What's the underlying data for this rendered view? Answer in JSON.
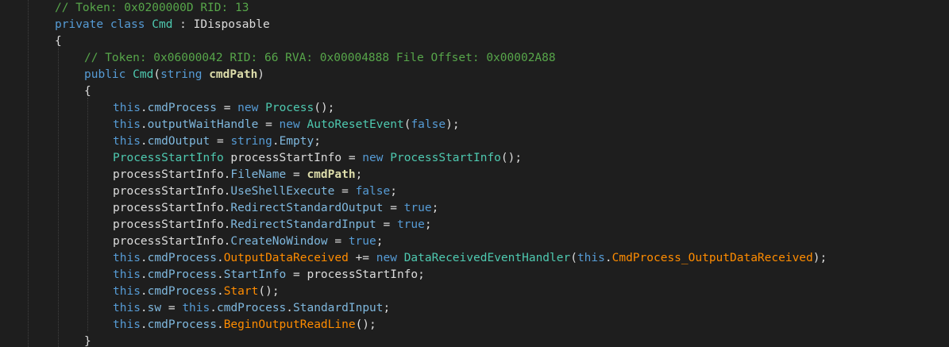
{
  "editor": {
    "lines": [
      {
        "indent": 0,
        "tokens": [
          {
            "t": "// Token: 0x0200000D RID: 13",
            "c": "cm"
          }
        ]
      },
      {
        "indent": 0,
        "tokens": [
          {
            "t": "private",
            "c": "kw"
          },
          {
            "t": " ",
            "c": "pn"
          },
          {
            "t": "class",
            "c": "kw"
          },
          {
            "t": " ",
            "c": "pn"
          },
          {
            "t": "Cmd",
            "c": "ty"
          },
          {
            "t": " : ",
            "c": "pn"
          },
          {
            "t": "IDisposable",
            "c": "pn"
          }
        ]
      },
      {
        "indent": 0,
        "tokens": [
          {
            "t": "{",
            "c": "pn"
          }
        ]
      },
      {
        "indent": 1,
        "tokens": [
          {
            "t": "// Token: 0x06000042 RID: 66 RVA: 0x00004888 File Offset: 0x00002A88",
            "c": "cm"
          }
        ]
      },
      {
        "indent": 1,
        "tokens": [
          {
            "t": "public",
            "c": "kw"
          },
          {
            "t": " ",
            "c": "pn"
          },
          {
            "t": "Cmd",
            "c": "ty"
          },
          {
            "t": "(",
            "c": "pn"
          },
          {
            "t": "string",
            "c": "kw"
          },
          {
            "t": " ",
            "c": "pn"
          },
          {
            "t": "cmdPath",
            "c": "prm"
          },
          {
            "t": ")",
            "c": "pn"
          }
        ]
      },
      {
        "indent": 1,
        "tokens": [
          {
            "t": "{",
            "c": "pn"
          }
        ]
      },
      {
        "indent": 2,
        "tokens": [
          {
            "t": "this",
            "c": "kw"
          },
          {
            "t": ".",
            "c": "pn"
          },
          {
            "t": "cmdProcess",
            "c": "pinfo"
          },
          {
            "t": " = ",
            "c": "pn"
          },
          {
            "t": "new",
            "c": "kw"
          },
          {
            "t": " ",
            "c": "pn"
          },
          {
            "t": "Process",
            "c": "ty"
          },
          {
            "t": "();",
            "c": "pn"
          }
        ]
      },
      {
        "indent": 2,
        "tokens": [
          {
            "t": "this",
            "c": "kw"
          },
          {
            "t": ".",
            "c": "pn"
          },
          {
            "t": "outputWaitHandle",
            "c": "pinfo"
          },
          {
            "t": " = ",
            "c": "pn"
          },
          {
            "t": "new",
            "c": "kw"
          },
          {
            "t": " ",
            "c": "pn"
          },
          {
            "t": "AutoResetEvent",
            "c": "ty"
          },
          {
            "t": "(",
            "c": "pn"
          },
          {
            "t": "false",
            "c": "kw"
          },
          {
            "t": ");",
            "c": "pn"
          }
        ]
      },
      {
        "indent": 2,
        "tokens": [
          {
            "t": "this",
            "c": "kw"
          },
          {
            "t": ".",
            "c": "pn"
          },
          {
            "t": "cmdOutput",
            "c": "pinfo"
          },
          {
            "t": " = ",
            "c": "pn"
          },
          {
            "t": "string",
            "c": "kw"
          },
          {
            "t": ".",
            "c": "pn"
          },
          {
            "t": "Empty",
            "c": "pinfo"
          },
          {
            "t": ";",
            "c": "pn"
          }
        ]
      },
      {
        "indent": 2,
        "tokens": [
          {
            "t": "ProcessStartInfo",
            "c": "ty"
          },
          {
            "t": " processStartInfo = ",
            "c": "loc"
          },
          {
            "t": "new",
            "c": "kw"
          },
          {
            "t": " ",
            "c": "pn"
          },
          {
            "t": "ProcessStartInfo",
            "c": "ty"
          },
          {
            "t": "();",
            "c": "pn"
          }
        ]
      },
      {
        "indent": 2,
        "tokens": [
          {
            "t": "processStartInfo.",
            "c": "loc"
          },
          {
            "t": "FileName",
            "c": "pinfo"
          },
          {
            "t": " = ",
            "c": "pn"
          },
          {
            "t": "cmdPath",
            "c": "prm"
          },
          {
            "t": ";",
            "c": "pn"
          }
        ]
      },
      {
        "indent": 2,
        "tokens": [
          {
            "t": "processStartInfo.",
            "c": "loc"
          },
          {
            "t": "UseShellExecute",
            "c": "pinfo"
          },
          {
            "t": " = ",
            "c": "pn"
          },
          {
            "t": "false",
            "c": "kw"
          },
          {
            "t": ";",
            "c": "pn"
          }
        ]
      },
      {
        "indent": 2,
        "tokens": [
          {
            "t": "processStartInfo.",
            "c": "loc"
          },
          {
            "t": "RedirectStandardOutput",
            "c": "pinfo"
          },
          {
            "t": " = ",
            "c": "pn"
          },
          {
            "t": "true",
            "c": "kw"
          },
          {
            "t": ";",
            "c": "pn"
          }
        ]
      },
      {
        "indent": 2,
        "tokens": [
          {
            "t": "processStartInfo.",
            "c": "loc"
          },
          {
            "t": "RedirectStandardInput",
            "c": "pinfo"
          },
          {
            "t": " = ",
            "c": "pn"
          },
          {
            "t": "true",
            "c": "kw"
          },
          {
            "t": ";",
            "c": "pn"
          }
        ]
      },
      {
        "indent": 2,
        "tokens": [
          {
            "t": "processStartInfo.",
            "c": "loc"
          },
          {
            "t": "CreateNoWindow",
            "c": "pinfo"
          },
          {
            "t": " = ",
            "c": "pn"
          },
          {
            "t": "true",
            "c": "kw"
          },
          {
            "t": ";",
            "c": "pn"
          }
        ]
      },
      {
        "indent": 2,
        "tokens": [
          {
            "t": "this",
            "c": "kw"
          },
          {
            "t": ".",
            "c": "pn"
          },
          {
            "t": "cmdProcess",
            "c": "pinfo"
          },
          {
            "t": ".",
            "c": "pn"
          },
          {
            "t": "OutputDataReceived",
            "c": "ev"
          },
          {
            "t": " += ",
            "c": "pn"
          },
          {
            "t": "new",
            "c": "kw"
          },
          {
            "t": " ",
            "c": "pn"
          },
          {
            "t": "DataReceivedEventHandler",
            "c": "ty"
          },
          {
            "t": "(",
            "c": "pn"
          },
          {
            "t": "this",
            "c": "kw"
          },
          {
            "t": ".",
            "c": "pn"
          },
          {
            "t": "CmdProcess_OutputDataReceived",
            "c": "mm"
          },
          {
            "t": ");",
            "c": "pn"
          }
        ]
      },
      {
        "indent": 2,
        "tokens": [
          {
            "t": "this",
            "c": "kw"
          },
          {
            "t": ".",
            "c": "pn"
          },
          {
            "t": "cmdProcess",
            "c": "pinfo"
          },
          {
            "t": ".",
            "c": "pn"
          },
          {
            "t": "StartInfo",
            "c": "pinfo"
          },
          {
            "t": " = processStartInfo;",
            "c": "loc"
          }
        ]
      },
      {
        "indent": 2,
        "tokens": [
          {
            "t": "this",
            "c": "kw"
          },
          {
            "t": ".",
            "c": "pn"
          },
          {
            "t": "cmdProcess",
            "c": "pinfo"
          },
          {
            "t": ".",
            "c": "pn"
          },
          {
            "t": "Start",
            "c": "mm"
          },
          {
            "t": "();",
            "c": "pn"
          }
        ]
      },
      {
        "indent": 2,
        "tokens": [
          {
            "t": "this",
            "c": "kw"
          },
          {
            "t": ".",
            "c": "pn"
          },
          {
            "t": "sw",
            "c": "pinfo"
          },
          {
            "t": " = ",
            "c": "pn"
          },
          {
            "t": "this",
            "c": "kw"
          },
          {
            "t": ".",
            "c": "pn"
          },
          {
            "t": "cmdProcess",
            "c": "pinfo"
          },
          {
            "t": ".",
            "c": "pn"
          },
          {
            "t": "StandardInput",
            "c": "pinfo"
          },
          {
            "t": ";",
            "c": "pn"
          }
        ]
      },
      {
        "indent": 2,
        "tokens": [
          {
            "t": "this",
            "c": "kw"
          },
          {
            "t": ".",
            "c": "pn"
          },
          {
            "t": "cmdProcess",
            "c": "pinfo"
          },
          {
            "t": ".",
            "c": "pn"
          },
          {
            "t": "BeginOutputReadLine",
            "c": "mm"
          },
          {
            "t": "();",
            "c": "pn"
          }
        ]
      },
      {
        "indent": 1,
        "tokens": [
          {
            "t": "}",
            "c": "pn"
          }
        ]
      }
    ],
    "colors": {
      "background": "#1e1e1e",
      "comment": "#57a64a",
      "keyword": "#569cd6",
      "type": "#4ec9b0",
      "parameter": "#dcdcaa",
      "member": "#7fb8de",
      "method": "#ff8c00",
      "plain": "#dcdcdc"
    }
  }
}
